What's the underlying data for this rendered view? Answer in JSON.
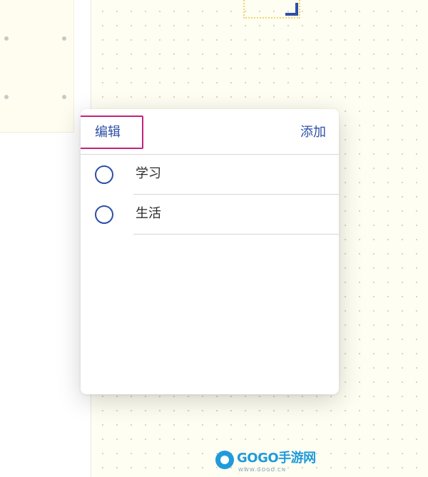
{
  "popover": {
    "edit_label": "编辑",
    "add_label": "添加",
    "items": [
      {
        "label": "学习"
      },
      {
        "label": "生活"
      }
    ]
  },
  "colors": {
    "accent": "#2e4fa6",
    "highlight": "#c3237d",
    "canvas": "#fffef3",
    "selection": "#f0d766"
  },
  "watermark": {
    "brand": "GOGO手游网",
    "url": "WWW.GOGO.CN"
  },
  "icons": {
    "radio": "radio-circle-icon",
    "logo": "gogo-logo-icon",
    "handle": "resize-handle-icon"
  }
}
